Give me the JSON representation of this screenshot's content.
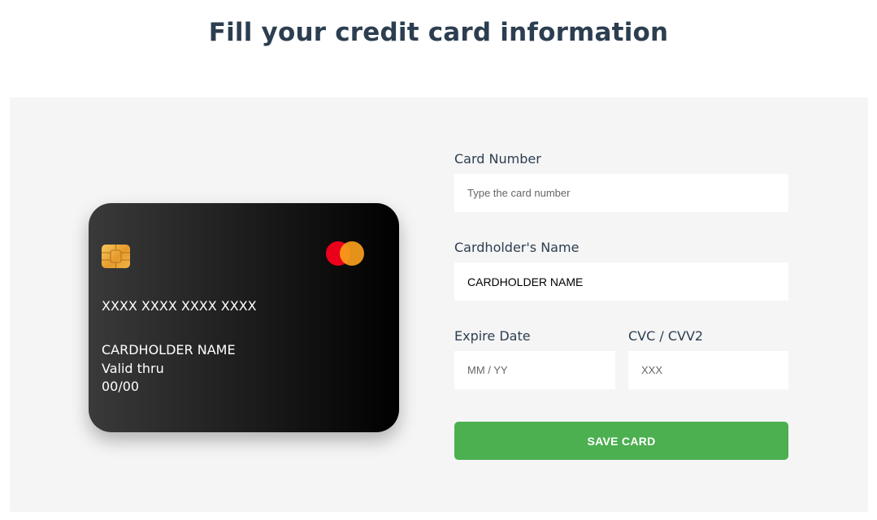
{
  "page": {
    "title": "Fill your credit card information"
  },
  "card": {
    "number": "XXXX XXXX XXXX XXXX",
    "holder": "CARDHOLDER NAME",
    "valid_label": "Valid thru",
    "expiry": "00/00",
    "brand_icon": "mastercard-logo-icon",
    "chip_icon": "card-chip-icon"
  },
  "form": {
    "card_number": {
      "label": "Card Number",
      "placeholder": "Type the card number",
      "value": ""
    },
    "cardholder_name": {
      "label": "Cardholder's Name",
      "placeholder": "",
      "value": "CARDHOLDER NAME"
    },
    "expire_date": {
      "label": "Expire Date",
      "placeholder": "MM / YY",
      "value": ""
    },
    "cvc": {
      "label": "CVC / CVV2",
      "placeholder": "XXX",
      "value": ""
    },
    "save_label": "SAVE CARD"
  },
  "colors": {
    "title": "#2c3e50",
    "panel_background": "#f5f5f5",
    "save_button": "#4caf50",
    "mastercard_red": "#eb001b",
    "mastercard_orange": "#f79e1b"
  }
}
